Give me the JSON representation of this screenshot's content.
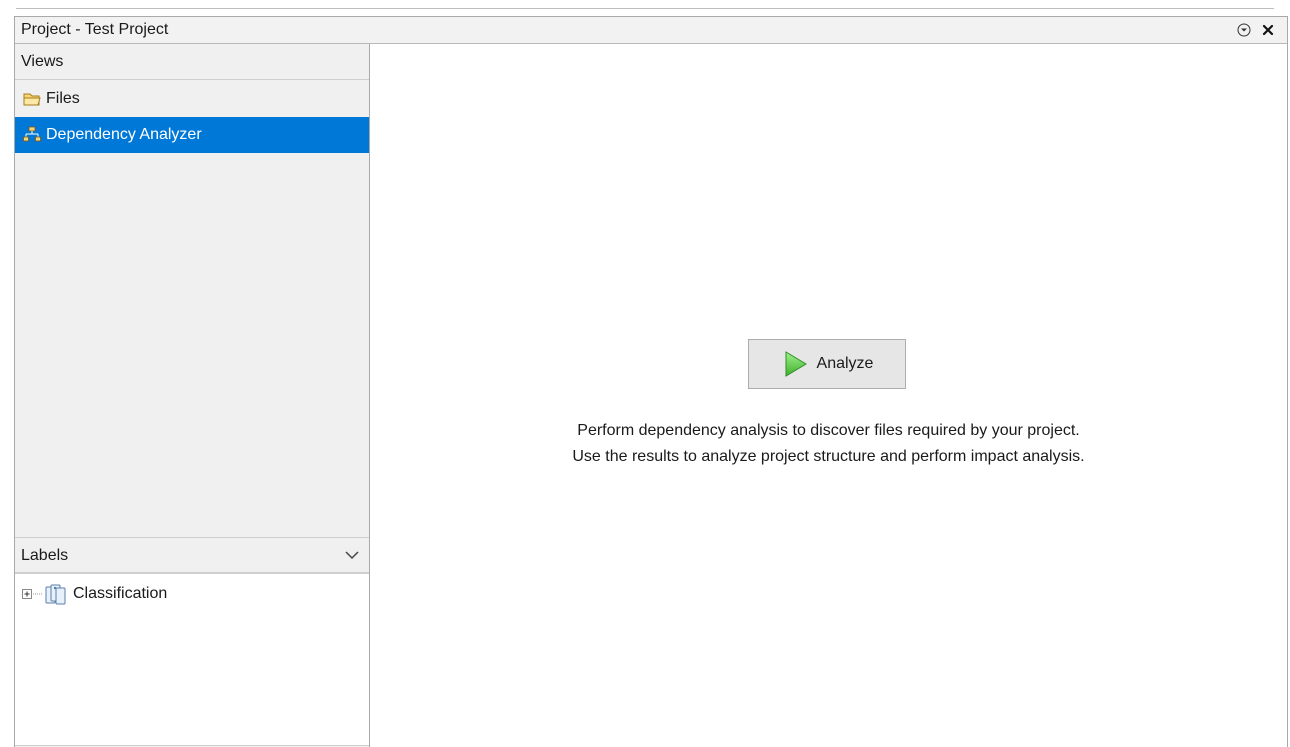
{
  "panel": {
    "title": "Project - Test Project"
  },
  "views": {
    "header": "Views",
    "items": [
      {
        "label": "Files",
        "icon": "folder-icon",
        "selected": false
      },
      {
        "label": "Dependency Analyzer",
        "icon": "hierarchy-icon",
        "selected": true
      }
    ]
  },
  "labels": {
    "header": "Labels",
    "tree": [
      {
        "label": "Classification",
        "icon": "label-category-icon",
        "expanded": false
      }
    ]
  },
  "main": {
    "analyze_label": "Analyze",
    "description_line1": "Perform dependency analysis to discover files required by your project.",
    "description_line2": "Use the results to analyze project structure and perform impact analysis."
  },
  "colors": {
    "selection": "#0078d7",
    "play_icon": "#5cc447",
    "panel_bg": "#f0f0f0"
  }
}
